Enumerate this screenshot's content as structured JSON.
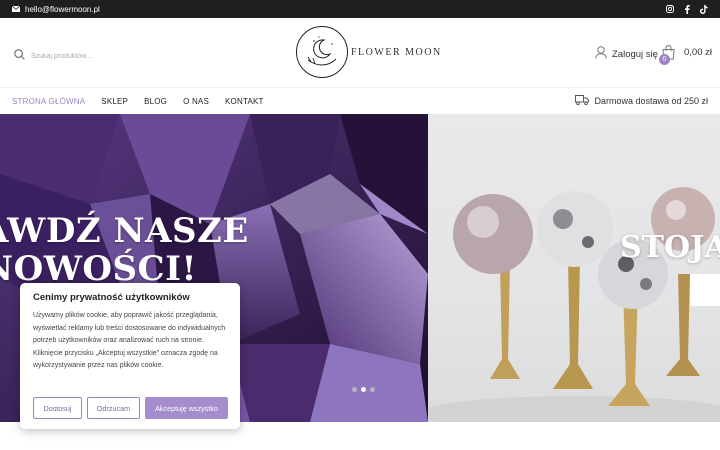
{
  "topbar": {
    "email": "hello@flowermoon.pl",
    "socials": [
      "instagram-icon",
      "facebook-icon",
      "tiktok-icon"
    ]
  },
  "header": {
    "search_placeholder": "Szukaj produktów...",
    "brand": "FLOWER MOON",
    "account_label": "Zaloguj się",
    "cart_count": "0",
    "cart_total": "0,00 zł"
  },
  "nav": {
    "items": [
      {
        "label": "STRONA GŁÓWNA",
        "active": true
      },
      {
        "label": "SKLEP"
      },
      {
        "label": "BLOG"
      },
      {
        "label": "O NAS"
      },
      {
        "label": "KONTAKT"
      }
    ],
    "delivery": "Darmowa dostawa od 250 zł"
  },
  "hero": {
    "slide1_line1": "AWDŹ NASZE",
    "slide1_line2": "NOWOŚCI!",
    "slide2_title": "STOJA",
    "active_dot": 1
  },
  "cookie": {
    "title": "Cenimy prywatność użytkowników",
    "text": "Używamy plików cookie, aby poprawić jakość przeglądania, wyświetlać reklamy lub treści dostosowane do indywidualnych potrzeb użytkowników oraz analizować ruch na stronie. Kliknięcie przycisku „Akceptuj wszystkie” oznacza zgodę na wykorzystywanie przez nas plików cookie.",
    "customize": "Dostosuj",
    "reject": "Odrzucam",
    "accept": "Akceptuję wszystko"
  },
  "colors": {
    "accent": "#9b83c6",
    "topbar": "#1f1f1f"
  }
}
